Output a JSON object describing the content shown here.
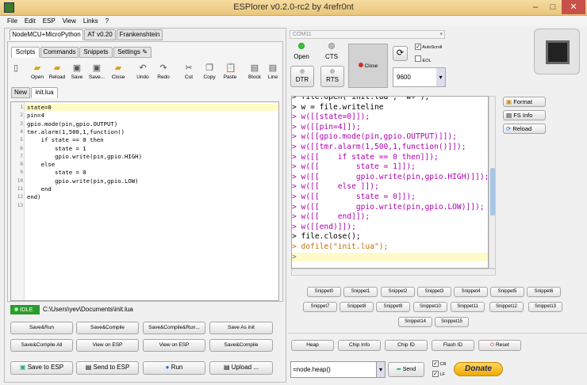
{
  "window": {
    "title": "ESPlorer v0.2.0-rc2 by 4refr0nt",
    "minimize": "–",
    "maximize": "□",
    "close": "✕"
  },
  "menu": [
    "File",
    "Edit",
    "ESP",
    "View",
    "Links",
    "?"
  ],
  "device_tabs": [
    "NodeMCU+MicroPython",
    "AT v0.20",
    "Frankenshtein"
  ],
  "sub_tabs": [
    "Scripts",
    "Commands",
    "Snippets",
    "Settings"
  ],
  "toolbar": [
    "Open",
    "Reload",
    "Save",
    "Save...",
    "Close",
    "Undo",
    "Redo",
    "Cut",
    "Copy",
    "Paste",
    "Block",
    "Line"
  ],
  "file_tabs": [
    "New",
    "init.lua"
  ],
  "code_lines": [
    "state=0",
    "pin=4",
    "gpio.mode(pin,gpio.OUTPUT)",
    "tmr.alarm(1,500,1,function()",
    "    if state == 0 then",
    "        state = 1",
    "        gpio.write(pin,gpio.HIGH)",
    "    else",
    "        state = 0",
    "        gpio.write(pin,gpio.LOW)",
    "    end",
    "end)",
    ""
  ],
  "line_numbers": [
    "1",
    "2",
    "3",
    "4",
    "5",
    "6",
    "7",
    "8",
    "9",
    "10",
    "11",
    "12",
    "13"
  ],
  "status": {
    "state": "IDLE",
    "path": "C:\\Users\\yev\\Documents\\init.lua"
  },
  "save_buttons": [
    "Save&Run",
    "Save&Compile",
    "Save&Compile&Run...",
    "Save As init",
    "Save&Compile All",
    "View on ESP",
    "View on ESP",
    "Save&Compile"
  ],
  "bottom_buttons": {
    "save_to_esp": "Save to ESP",
    "send_to_esp": "Send to ESP",
    "run": "Run",
    "upload": "Upload ..."
  },
  "port": {
    "name": "COM11",
    "open": "Open",
    "cts": "CTS",
    "dtr": "DTR",
    "rts": "RTS",
    "close": "Close",
    "autoscroll": "AutoScroll",
    "eol": "EOL",
    "baud": "9600"
  },
  "terminal_lines": [
    "> file.open(\"init.lua\", \"w+\");",
    "> w = file.writeline",
    "> w([[state=0]]);",
    "> w([[pin=4]]);",
    "> w([[gpio.mode(pin,gpio.OUTPUT)]]);",
    "> w([[tmr.alarm(1,500,1,function()]]);",
    "> w([[    if state == 0 then]]);",
    "> w([[        state = 1]]);",
    "> w([[        gpio.write(pin,gpio.HIGH)]]);",
    "> w([[    else ]]);",
    "> w([[        state = 0]]);",
    "> w([[        gpio.write(pin,gpio.LOW)]]);",
    "> w([[    end]]);",
    "> w([[end)]]);",
    "> file.close();",
    "> dofile(\"init.lua\");",
    ">"
  ],
  "side_buttons": [
    "Format",
    "FS Info",
    "Reload"
  ],
  "snippets": [
    "Snippet0",
    "Snippet1",
    "Snippet2",
    "Snippet3",
    "Snippet4",
    "Snippet5",
    "Snippet6",
    "Snippet7",
    "Snippet8",
    "Snippet9",
    "Snippet10",
    "Snippet11",
    "Snippet12",
    "Snippet13",
    "Snippet14",
    "Snippet15"
  ],
  "info_buttons": [
    "Heap",
    "Chip Info",
    "Chip ID",
    "Flash ID",
    "Reset"
  ],
  "command": {
    "value": "=node.heap()",
    "send": "Send",
    "cr": "CR",
    "lf": "LF",
    "donate": "Donate"
  },
  "colors": {
    "idle": "#2d9a2d",
    "titlebar": "#efd08e",
    "current_line": "#fffbc8"
  }
}
